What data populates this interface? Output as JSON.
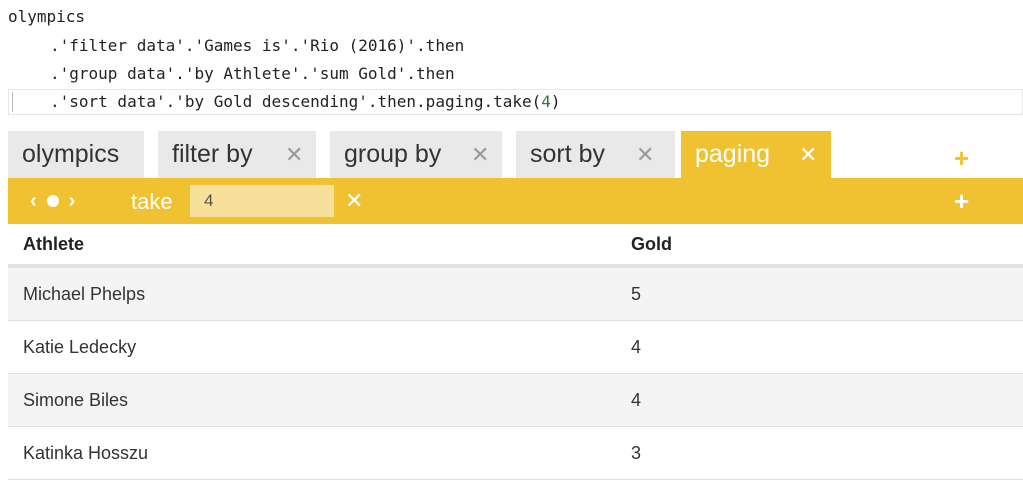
{
  "code": {
    "line1": "olympics",
    "line2": ".'filter data'.'Games is'.'Rio (2016)'.then",
    "line3": ".'group data'.'by Athlete'.'sum Gold'.then",
    "line4_prefix": ".'sort data'.'by Gold descending'.then.paging.take(",
    "line4_number": "4",
    "line4_suffix": ")"
  },
  "tabs": [
    {
      "label": "olympics",
      "close": ""
    },
    {
      "label": "filter by",
      "close": "✕"
    },
    {
      "label": "group by",
      "close": "✕"
    },
    {
      "label": "sort by",
      "close": "✕"
    },
    {
      "label": "paging",
      "close": "✕"
    }
  ],
  "tabs_add": "+",
  "toolbar": {
    "prev": "‹",
    "next": "›",
    "take_label": "take",
    "take_value": "4",
    "remove": "✕",
    "add": "+"
  },
  "table": {
    "headers": [
      "Athlete",
      "Gold"
    ],
    "rows": [
      [
        "Michael Phelps",
        "5"
      ],
      [
        "Katie Ledecky",
        "4"
      ],
      [
        "Simone Biles",
        "4"
      ],
      [
        "Katinka Hosszu",
        "3"
      ]
    ]
  },
  "colors": {
    "accent": "#f0c232",
    "tab_bg": "#e9e9e9",
    "input_bg": "#f7e19a"
  }
}
